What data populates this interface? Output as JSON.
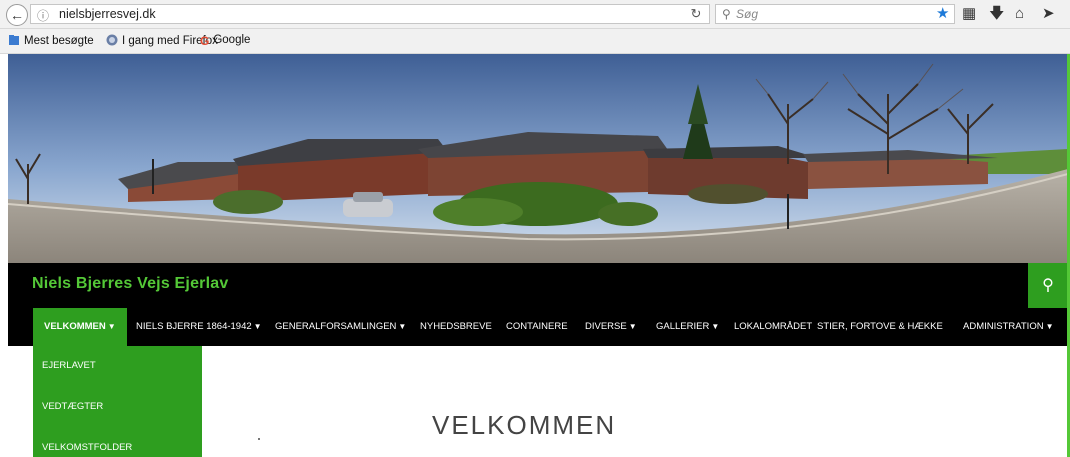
{
  "browser": {
    "url": "nielsbjerresvej.dk",
    "search_placeholder": "Søg",
    "bookmarks": [
      {
        "label": "Mest besøgte",
        "icon": "bookmarks-folder-icon"
      },
      {
        "label": "I gang med Firefox",
        "icon": "firefox-icon"
      },
      {
        "label": "Google",
        "icon": "google-icon"
      }
    ]
  },
  "site": {
    "title": "Niels Bjerres Vejs Ejerlav",
    "accent_color": "#2e9e1f",
    "title_color": "#54c837"
  },
  "nav": {
    "items": [
      {
        "label": "VELKOMMEN",
        "dropdown": true,
        "active": true
      },
      {
        "label": "NIELS BJERRE 1864-1942",
        "dropdown": true
      },
      {
        "label": "GENERALFORSAMLINGEN",
        "dropdown": true
      },
      {
        "label": "NYHEDSBREVE",
        "dropdown": false
      },
      {
        "label": "CONTAINERE",
        "dropdown": false
      },
      {
        "label": "DIVERSE",
        "dropdown": true
      },
      {
        "label": "GALLERIER",
        "dropdown": true
      },
      {
        "label": "LOKALOMRÅDET",
        "dropdown": false
      },
      {
        "label": "STIER, FORTOVE & HÆKKE",
        "dropdown": false
      },
      {
        "label": "ADMINISTRATION",
        "dropdown": true
      }
    ],
    "submenu": [
      "EJERLAVET",
      "VEDTÆGTER",
      "VELKOMSTFOLDER"
    ]
  },
  "content": {
    "heading": "VELKOMMEN"
  }
}
